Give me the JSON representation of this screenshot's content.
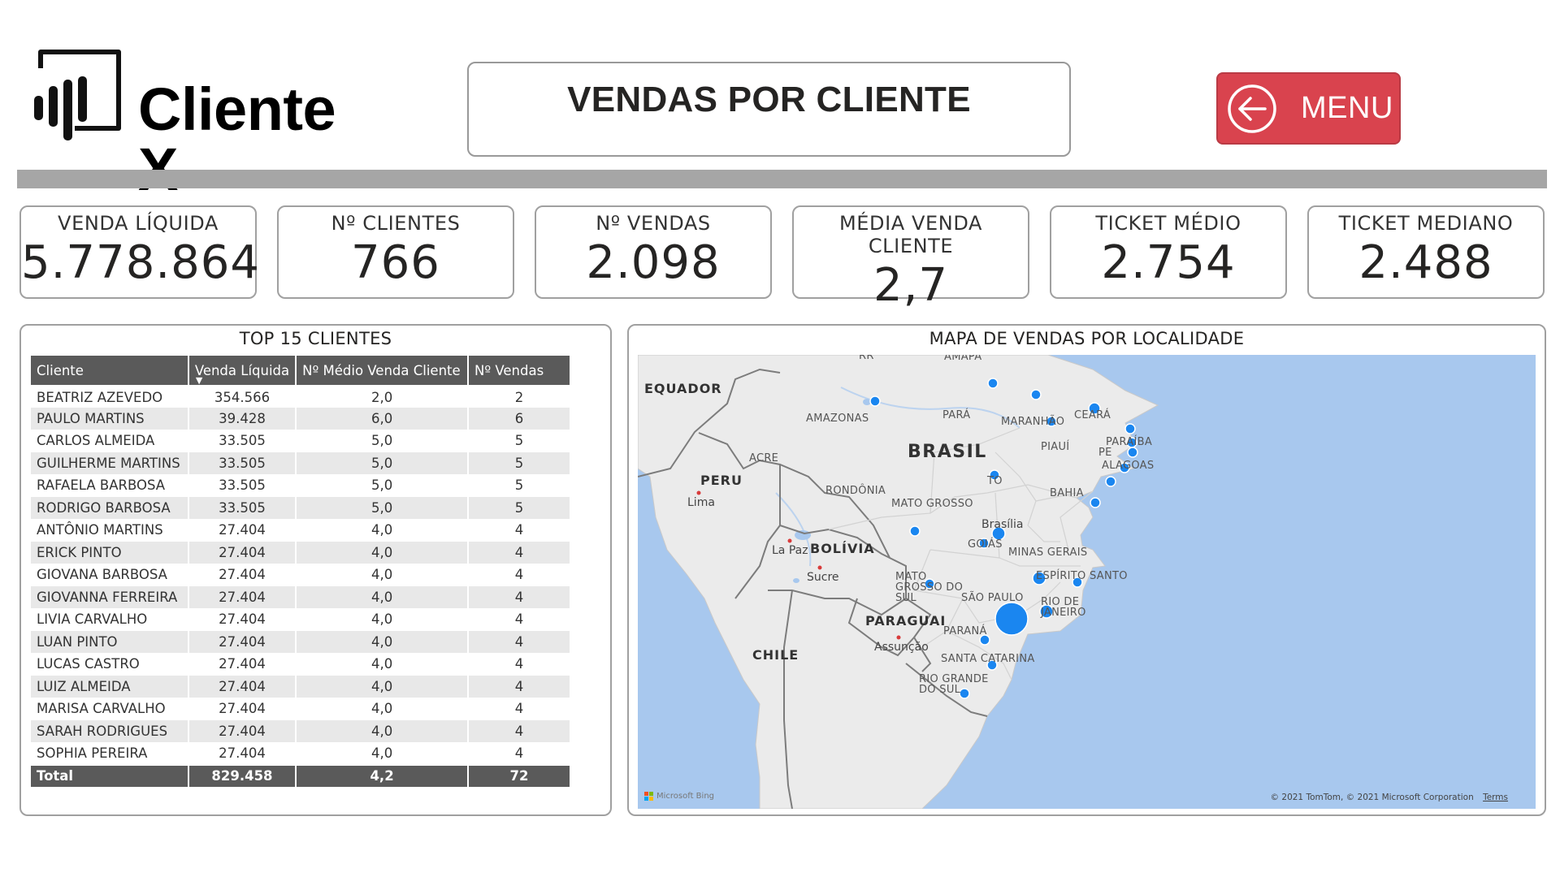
{
  "header": {
    "logo_text": "Cliente X",
    "title": "VENDAS POR CLIENTE",
    "menu_label": "MENU"
  },
  "colors": {
    "menu_button": "#d9434e",
    "divider": "#a6a6a6",
    "table_header": "#5a5a5a",
    "map_bubble": "#1a86f0",
    "map_water": "#a8c8ee",
    "map_land": "#ebebeb"
  },
  "icons": {
    "logo": "bar-chart-logo-icon",
    "menu": "arrow-left-circle-icon",
    "sort": "sort-descending-icon"
  },
  "kpis": [
    {
      "label": "VENDA LÍQUIDA",
      "value": "5.778.864"
    },
    {
      "label": "Nº CLIENTES",
      "value": "766"
    },
    {
      "label": "Nº VENDAS",
      "value": "2.098"
    },
    {
      "label": "MÉDIA VENDA CLIENTE",
      "value": "2,7"
    },
    {
      "label": "TICKET MÉDIO",
      "value": "2.754"
    },
    {
      "label": "TICKET MEDIANO",
      "value": "2.488"
    }
  ],
  "top_clients": {
    "title": "TOP 15 CLIENTES",
    "columns": [
      "Cliente",
      "Venda Líquida",
      "Nº Médio Venda Cliente",
      "Nº Vendas"
    ],
    "sorted_column": "Venda Líquida",
    "rows": [
      [
        "BEATRIZ AZEVEDO",
        "354.566",
        "2,0",
        "2"
      ],
      [
        "PAULO MARTINS",
        "39.428",
        "6,0",
        "6"
      ],
      [
        "CARLOS ALMEIDA",
        "33.505",
        "5,0",
        "5"
      ],
      [
        "GUILHERME MARTINS",
        "33.505",
        "5,0",
        "5"
      ],
      [
        "RAFAELA BARBOSA",
        "33.505",
        "5,0",
        "5"
      ],
      [
        "RODRIGO BARBOSA",
        "33.505",
        "5,0",
        "5"
      ],
      [
        "ANTÔNIO MARTINS",
        "27.404",
        "4,0",
        "4"
      ],
      [
        "ERICK PINTO",
        "27.404",
        "4,0",
        "4"
      ],
      [
        "GIOVANA BARBOSA",
        "27.404",
        "4,0",
        "4"
      ],
      [
        "GIOVANNA FERREIRA",
        "27.404",
        "4,0",
        "4"
      ],
      [
        "LIVIA CARVALHO",
        "27.404",
        "4,0",
        "4"
      ],
      [
        "LUAN PINTO",
        "27.404",
        "4,0",
        "4"
      ],
      [
        "LUCAS CASTRO",
        "27.404",
        "4,0",
        "4"
      ],
      [
        "LUIZ ALMEIDA",
        "27.404",
        "4,0",
        "4"
      ],
      [
        "MARISA CARVALHO",
        "27.404",
        "4,0",
        "4"
      ],
      [
        "SARAH RODRIGUES",
        "27.404",
        "4,0",
        "4"
      ],
      [
        "SOPHIA PEREIRA",
        "27.404",
        "4,0",
        "4"
      ]
    ],
    "total": [
      "Total",
      "829.458",
      "4,2",
      "72"
    ]
  },
  "map": {
    "title": "MAPA DE VENDAS POR LOCALIDADE",
    "countries": [
      "EQUADOR",
      "PERU",
      "BRASIL",
      "BOLÍVIA",
      "PARAGUAI",
      "CHILE"
    ],
    "regions": [
      "RR",
      "AMAPÁ",
      "AMAZONAS",
      "PARÁ",
      "MARANHÃO",
      "CEARÁ",
      "PIAUÍ",
      "PE",
      "PARAÍBA",
      "ALAGOAS",
      "ACRE",
      "RONDÔNIA",
      "TO",
      "BAHIA",
      "MATO GROSSO",
      "GOIÁS",
      "MINAS GERAIS",
      "ESPÍRITO SANTO",
      "MATO GROSSO DO SUL",
      "SÃO PAULO",
      "RIO DE JANEIRO",
      "PARANÁ",
      "SANTA CATARINA",
      "RIO GRANDE DO SUL"
    ],
    "cities": [
      "Lima",
      "La Paz",
      "Sucre",
      "Brasília",
      "Assunção"
    ],
    "brand": "Microsoft Bing",
    "copyright": "© 2021 TomTom, © 2021 Microsoft Corporation",
    "terms": "Terms"
  }
}
